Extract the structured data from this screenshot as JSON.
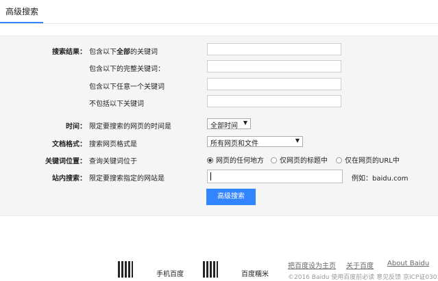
{
  "header": {
    "tab_label": "高级搜索"
  },
  "form": {
    "search_results": {
      "label": "搜索结果：",
      "all_keywords_pre": "包含以下",
      "all_keywords_bold": "全部",
      "all_keywords_post": "的关键词",
      "exact_phrase": "包含以下的完整关键词：",
      "any_keyword": "包含以下任意一个关键词",
      "exclude_keywords": "不包括以下关键词"
    },
    "time": {
      "label": "时间：",
      "desc": "限定要搜索的网页的时间是",
      "selected": "全部时间"
    },
    "format": {
      "label": "文档格式：",
      "desc": "搜索网页格式是",
      "selected": "所有网页和文件"
    },
    "position": {
      "label": "关键词位置：",
      "desc": "查询关键词位于",
      "options": [
        "网页的任何地方",
        "仅网页的标题中",
        "仅在网页的URL中"
      ]
    },
    "site": {
      "label": "站内搜索：",
      "desc": "限定要搜索指定的网站是",
      "example": "例如：baidu.com"
    },
    "submit_label": "高级搜索"
  },
  "footer": {
    "mobile_label": "手机百度",
    "app_label": "百度糯米",
    "links": [
      "把百度设为主页",
      "关于百度",
      "About Baidu"
    ],
    "copyright": "©2016 Baidu 使用百度前必读 意见反馈 京ICP证030173号"
  }
}
